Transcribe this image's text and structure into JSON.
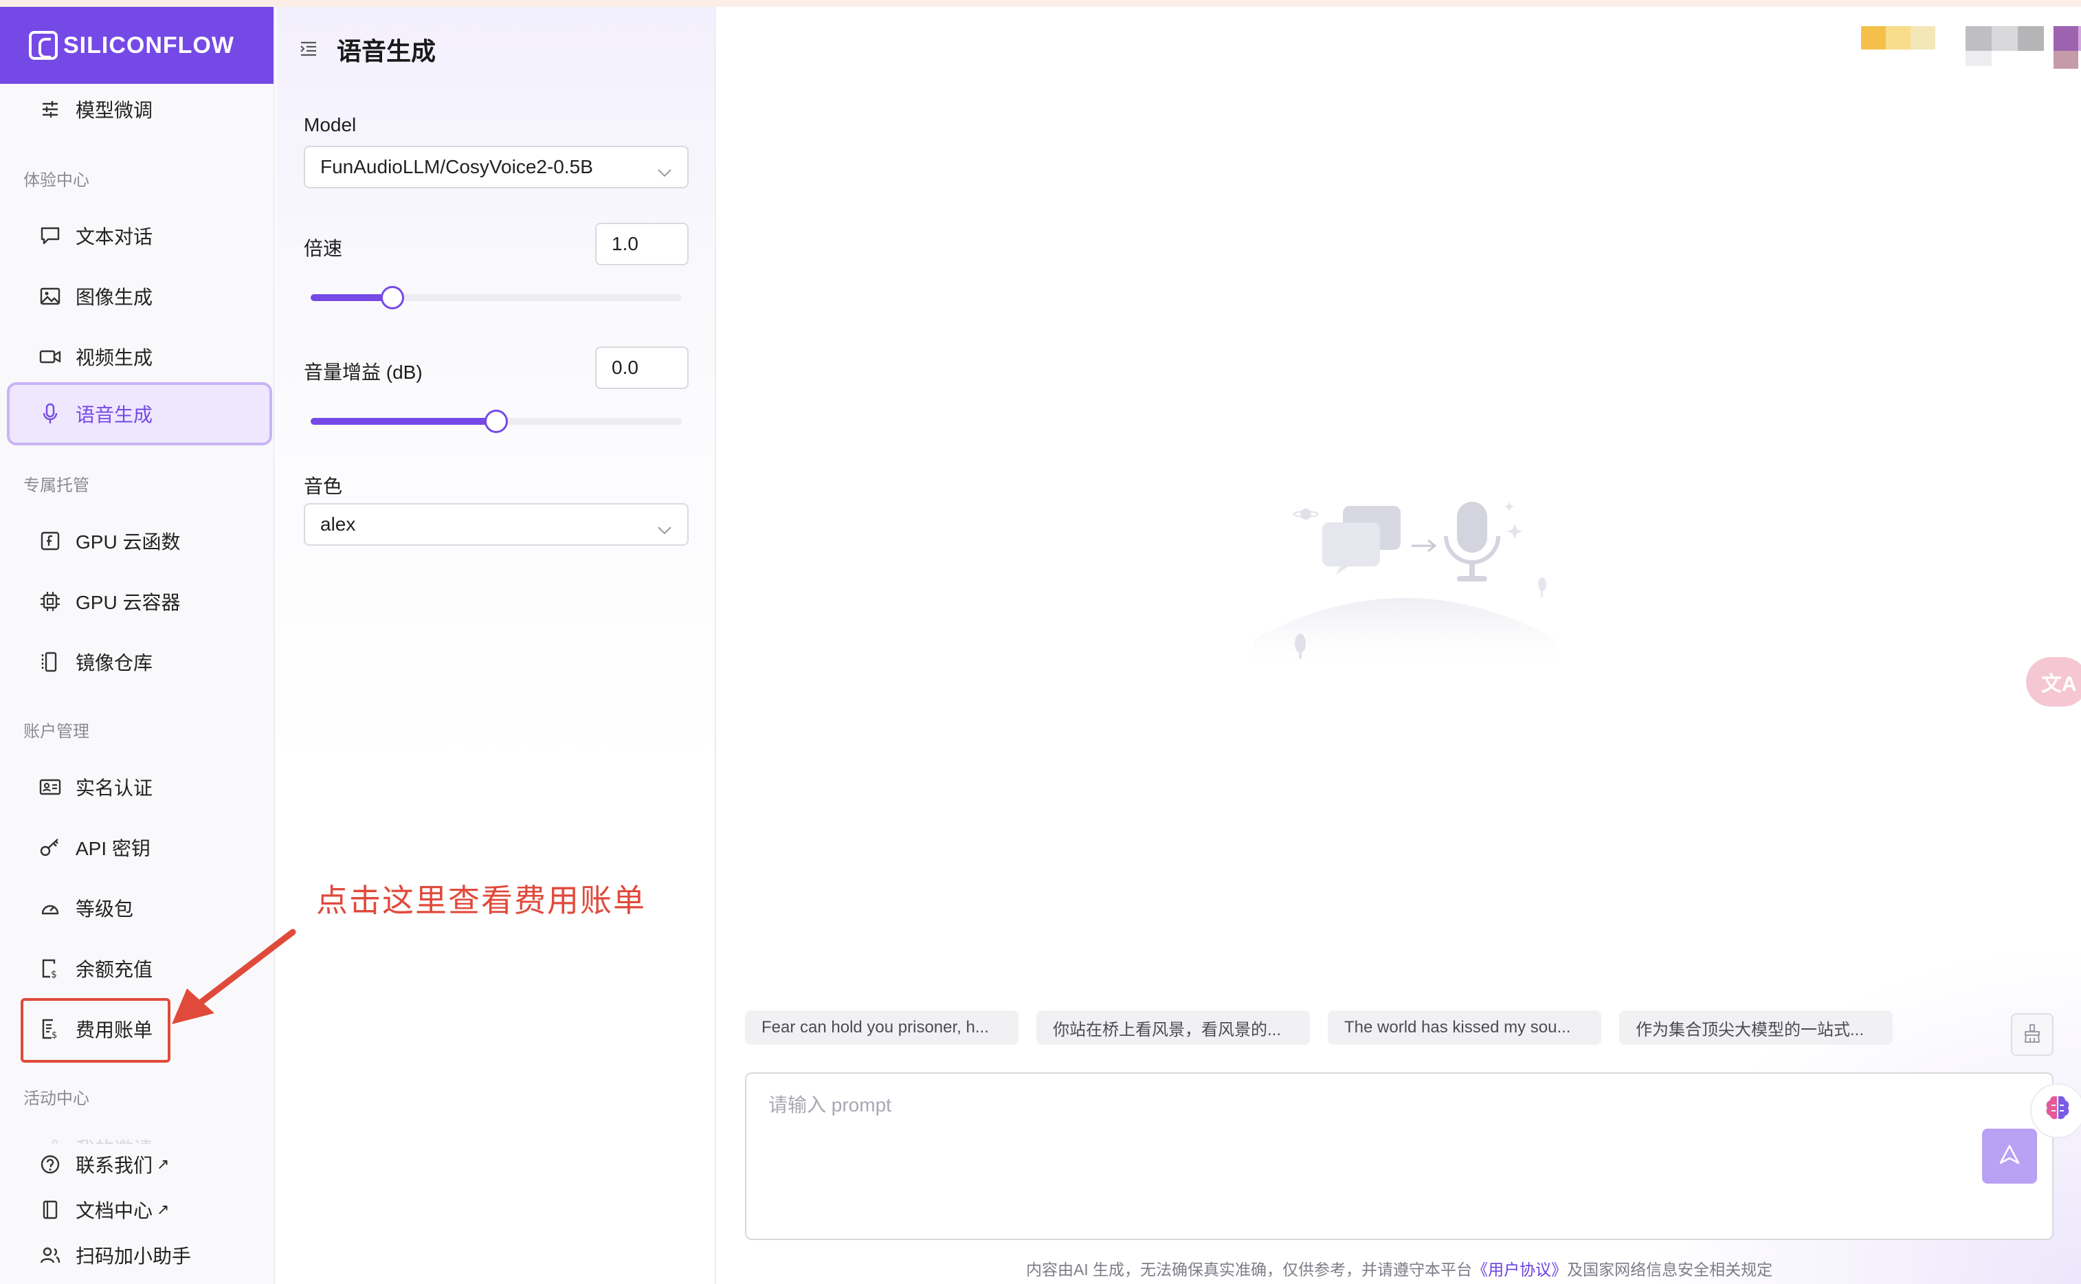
{
  "brand": {
    "name": "SILICONFLOW",
    "accent": "#7549e6",
    "annotation_color": "#e04a3b"
  },
  "sidebar": {
    "top_item": "模型微调",
    "groups": [
      {
        "title": "体验中心",
        "items": [
          "文本对话",
          "图像生成",
          "视频生成",
          "语音生成"
        ]
      },
      {
        "title": "专属托管",
        "items": [
          "GPU 云函数",
          "GPU 云容器",
          "镜像仓库"
        ]
      },
      {
        "title": "账户管理",
        "items": [
          "实名认证",
          "API 密钥",
          "等级包",
          "余额充值",
          "费用账单"
        ]
      },
      {
        "title": "活动中心",
        "items": [
          "我的邀请"
        ]
      }
    ],
    "active_item": "语音生成",
    "bottom_links": [
      "联系我们",
      "文档中心",
      "扫码加小助手"
    ],
    "external_mark": "↗"
  },
  "panel": {
    "title": "语音生成",
    "model_label": "Model",
    "model_value": "FunAudioLLM/CosyVoice2-0.5B",
    "speed_label": "倍速",
    "speed_value": "1.0",
    "speed_slider_fraction": 0.22,
    "gain_label": "音量增益 (dB)",
    "gain_value": "0.0",
    "gain_slider_fraction": 0.5,
    "voice_label": "音色",
    "voice_value": "alex"
  },
  "main": {
    "translate_badge": "文A",
    "chips": [
      "Fear can hold you prisoner, h...",
      "你站在桥上看风景，看风景的...",
      "The world has kissed my sou...",
      "作为集合顶尖大模型的一站式..."
    ],
    "prompt_placeholder": "请输入 prompt",
    "footer_prefix": "内容由AI 生成，无法确保真实准确，仅供参考，并请遵守本平台",
    "footer_link": "《用户协议》",
    "footer_suffix": "及国家网络信息安全相关规定"
  },
  "annotation": {
    "text": "点击这里查看费用账单"
  }
}
